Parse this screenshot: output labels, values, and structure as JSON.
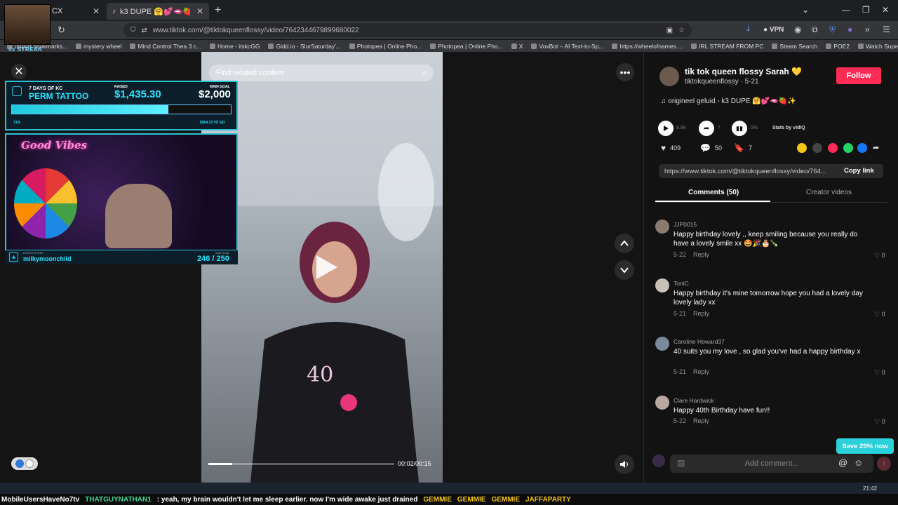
{
  "browser": {
    "tabs": [
      {
        "label": "CX"
      },
      {
        "label": "k3 DUPE 🤗💕🫦🍓✨ -"
      }
    ],
    "url": "www.tiktok.com/@tiktokqueenflossy/video/7642344679899680022",
    "vpn_label": "VPN",
    "bookmarks": [
      "Import bookmarks...",
      "mystery wheel",
      "Mind Control Thea 3 c...",
      "Home - itskcGG",
      "Gidd.io - SlurSaturday'...",
      "Photopea | Online Pho...",
      "Photopea | Online Pho...",
      "X",
      "VoxBot – AI Text-to-Sp...",
      "https://wheelofnames....",
      "IRL STREAM FROM PC",
      "Steam Search",
      "POE2",
      "Watch Supernatural - ..."
    ]
  },
  "overlay": {
    "streak": "4x STREAK",
    "goal_title_1": "7 DAYS OF KC",
    "goal_title_2": "PERM TATTOO",
    "raised_label": "RAISED",
    "raised_value": "$1,435.30",
    "main_goal_label": "MAIN GOAL",
    "main_goal_value": "$2,000",
    "progress_fraction": 0.71,
    "progress_percent": "71%",
    "remaining": "$564.70 TO GO",
    "good_vibes": "Good Vibes",
    "latest_event_label": "LATEST EVENT",
    "latest_event_user": "milkymoonchild",
    "sub_goal_label": "SUB GOAL",
    "sub_goal_value": "246 / 250"
  },
  "video": {
    "search_placeholder": "Find related content",
    "timecode": "00:02/00:15",
    "progress_fraction": 0.13
  },
  "creator": {
    "name": "tik tok queen flossy Sarah 💛",
    "handle": "tiktokqueenflossy · 5-21",
    "follow_label": "Follow",
    "music": "♫  origineel geluid - k3 DUPE 🤗💕🫦🍓✨"
  },
  "stats": {
    "views": "8.8K",
    "shares": "7",
    "percent": "5%",
    "stats_by": "Stats by vidIQ",
    "likes": "409",
    "comments": "50",
    "saves": "7"
  },
  "share": {
    "link": "https://www.tiktok.com/@tiktokqueenflossy/video/764...",
    "copy_label": "Copy link",
    "icon_colors": [
      "#f5c518",
      "#444444",
      "#fe2c55",
      "#25d366",
      "#1877f2"
    ]
  },
  "tabs": {
    "comments": "Comments (50)",
    "creator_videos": "Creator videos"
  },
  "comments": [
    {
      "user": "JJP0015",
      "text": "Happy birthday lovely ,, keep smiling because you really do have a lovely smile xx 🤩🎉🎂🍾",
      "date": "5-22",
      "reply": "Reply",
      "likes": "0"
    },
    {
      "user": "ToniC",
      "text": "Happy birthday it's mine tomorrow hope you had a lovely day lovely lady xx",
      "date": "5-21",
      "reply": "Reply",
      "likes": "0"
    },
    {
      "user": "Caroline Howard37",
      "text": "40 suits you my love , so glad you've had a happy birthday x",
      "date": "5-21",
      "reply": "Reply",
      "likes": "0"
    },
    {
      "user": "Clare Hardwick",
      "text": "Happy 40th Birthday have fun!!",
      "date": "5-22",
      "reply": "Reply",
      "likes": "0"
    }
  ],
  "save_button": "Save 25% now",
  "comment_input_placeholder": "Add comment...",
  "ticker": {
    "user1": "MobileUsersHaveNo7tv",
    "user2": "THATGUYNATHAN1",
    "message": ": yeah, my brain wouldn't let me sleep earlier. now I'm wide awake just drained",
    "emote1": "GEMMIE",
    "emote2": "GEMMIE",
    "emote3": "GEMMIE",
    "user3": "JAFFAPARTY"
  },
  "clock": "21:42"
}
